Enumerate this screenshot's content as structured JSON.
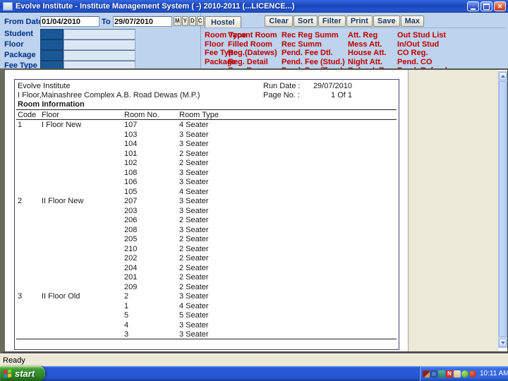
{
  "window": {
    "title": "Evolve Institute - Institute Management System ( -) 2010-2011 (...LICENCE...)"
  },
  "filters": {
    "from_date_label": "From Date",
    "from_date_value": "01/04/2010",
    "to_label": "To",
    "to_date_value": "29/07/2010",
    "date_buttons": [
      "M",
      "Y",
      "D",
      "C"
    ],
    "fields": [
      {
        "label": "Student"
      },
      {
        "label": "Floor"
      },
      {
        "label": "Package"
      },
      {
        "label": "Fee Type"
      }
    ]
  },
  "toolbar": {
    "tab_label": "Hostel",
    "buttons": [
      "Clear",
      "Sort",
      "Filter",
      "Print",
      "Save",
      "Max"
    ]
  },
  "menu": {
    "columns": [
      [
        "Room Type",
        "Floor",
        "Fee Type",
        "Package"
      ],
      [
        "Vacant Room",
        "Filled Room",
        "Reg.(Datews)",
        "Reg. Detail",
        "Rec. Reg"
      ],
      [
        "Rec Reg Summ",
        "Rec Summ",
        "Pend. Fee Dtl.",
        "Pend. Fee (Stud.)",
        "Pend. Fee (Type)"
      ],
      [
        "Att. Reg",
        "Mess Att.",
        "House Att.",
        "Night Att.",
        "Refund. Reg"
      ],
      [
        "Out Stud List",
        "In/Out Stud",
        "CO Reg.",
        "Pend. CO",
        "Pend. Refund"
      ]
    ]
  },
  "report": {
    "institute_name": "Evolve Institute",
    "address": "I Floor,Mainashree Complex A.B. Road Dewas (M.P.)",
    "run_date_label": "Run Date :",
    "run_date_value": "29/07/2010",
    "page_no_label": "Page No. :",
    "page_no_value": "1 Of 1",
    "section_title": "Room Information",
    "columns": [
      "Code",
      "Floor",
      "Room No.",
      "Room Type"
    ],
    "groups": [
      {
        "code": "1",
        "floor": "I Floor New",
        "rooms": [
          [
            "107",
            "4 Seater"
          ],
          [
            "103",
            "3 Seater"
          ],
          [
            "104",
            "3 Seater"
          ],
          [
            "101",
            "2 Seater"
          ],
          [
            "102",
            "2 Seater"
          ],
          [
            "108",
            "3 Seater"
          ],
          [
            "106",
            "3 Seater"
          ],
          [
            "105",
            "4 Seater"
          ]
        ]
      },
      {
        "code": "2",
        "floor": "II Floor New",
        "rooms": [
          [
            "207",
            "3 Seater"
          ],
          [
            "203",
            "3 Seater"
          ],
          [
            "206",
            "2 Seater"
          ],
          [
            "208",
            "3 Seater"
          ],
          [
            "205",
            "2 Seater"
          ],
          [
            "210",
            "2 Seater"
          ],
          [
            "202",
            "2 Seater"
          ],
          [
            "204",
            "2 Seater"
          ],
          [
            "201",
            "2 Seater"
          ],
          [
            "209",
            "2 Seater"
          ]
        ]
      },
      {
        "code": "3",
        "floor": "II Floor Old",
        "rooms": [
          [
            "2",
            "3 Seater"
          ],
          [
            "1",
            "4 Seater"
          ],
          [
            "5",
            "5 Seater"
          ],
          [
            "4",
            "3 Seater"
          ],
          [
            "3",
            "3 Seater"
          ]
        ]
      }
    ]
  },
  "statusbar": {
    "text": "Ready"
  },
  "taskbar": {
    "start_label": "start",
    "time": "10:11 AM",
    "tray_icons": [
      "maroon-app",
      "display",
      "network-status",
      "n-logo",
      "notes-app",
      "green-status",
      "red-alert"
    ]
  },
  "colors": {
    "titlebar_blue": "#1b47bd",
    "panel_blue": "#bdd3ee",
    "label_navy": "#003087",
    "link_red": "#c00000",
    "field_dark_blue": "#1a5796",
    "beige": "#ece9d8",
    "taskbar_blue": "#2456d2",
    "start_green": "#2e8326"
  }
}
